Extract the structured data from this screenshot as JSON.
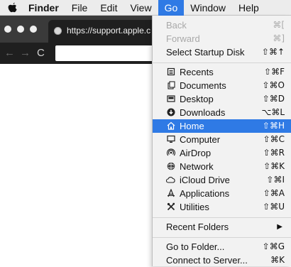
{
  "menubar": {
    "apple_icon": "apple-logo-icon",
    "app_name": "Finder",
    "menus": [
      "File",
      "Edit",
      "View",
      "Go",
      "Window",
      "Help"
    ],
    "active_menu": "Go"
  },
  "browser": {
    "tab_title": "https://support.apple.c",
    "url": "",
    "back_glyph": "←",
    "forward_glyph": "→",
    "reload_glyph": "C"
  },
  "go_menu": {
    "back": {
      "label": "Back",
      "shortcut": "⌘["
    },
    "forward": {
      "label": "Forward",
      "shortcut": "⌘]"
    },
    "startup_disk": {
      "label": "Select Startup Disk",
      "shortcut": "⇧⌘↑"
    },
    "recents": {
      "label": "Recents",
      "shortcut": "⇧⌘F",
      "icon": "recents-icon"
    },
    "documents": {
      "label": "Documents",
      "shortcut": "⇧⌘O",
      "icon": "documents-icon"
    },
    "desktop": {
      "label": "Desktop",
      "shortcut": "⇧⌘D",
      "icon": "desktop-icon"
    },
    "downloads": {
      "label": "Downloads",
      "shortcut": "⌥⌘L",
      "icon": "downloads-icon"
    },
    "home": {
      "label": "Home",
      "shortcut": "⇧⌘H",
      "icon": "home-icon"
    },
    "computer": {
      "label": "Computer",
      "shortcut": "⇧⌘C",
      "icon": "computer-icon"
    },
    "airdrop": {
      "label": "AirDrop",
      "shortcut": "⇧⌘R",
      "icon": "airdrop-icon"
    },
    "network": {
      "label": "Network",
      "shortcut": "⇧⌘K",
      "icon": "network-icon"
    },
    "icloud": {
      "label": "iCloud Drive",
      "shortcut": "⇧⌘I",
      "icon": "icloud-icon"
    },
    "applications": {
      "label": "Applications",
      "shortcut": "⇧⌘A",
      "icon": "applications-icon"
    },
    "utilities": {
      "label": "Utilities",
      "shortcut": "⇧⌘U",
      "icon": "utilities-icon"
    },
    "recent_folders": {
      "label": "Recent Folders",
      "arrow": "▶"
    },
    "goto_folder": {
      "label": "Go to Folder...",
      "shortcut": "⇧⌘G"
    },
    "connect_server": {
      "label": "Connect to Server...",
      "shortcut": "⌘K"
    }
  },
  "colors": {
    "highlight": "#2f7ae5",
    "menu_bg": "#f2f2f2",
    "browser_dark": "#1f1f1f"
  }
}
